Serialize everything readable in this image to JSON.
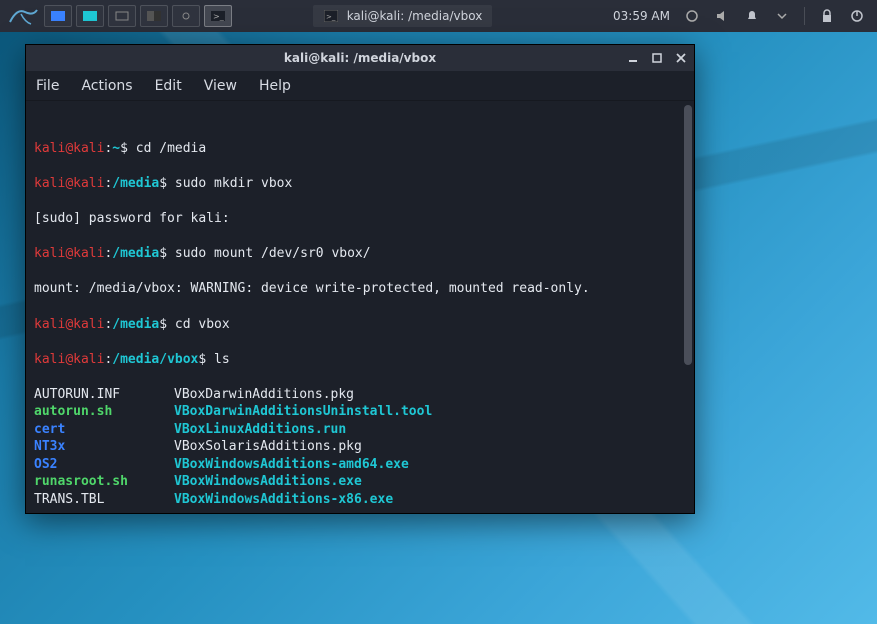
{
  "panel": {
    "window_title": "kali@kali: /media/vbox",
    "clock": "03:59 AM"
  },
  "terminal": {
    "titlebar": "kali@kali: /media/vbox",
    "menus": {
      "file": "File",
      "actions": "Actions",
      "edit": "Edit",
      "view": "View",
      "help": "Help"
    },
    "prompts": {
      "user": "kali",
      "at": "@",
      "host": "kali",
      "sep": ":",
      "tilde": "~",
      "dollar": "$",
      "path_media": "/media",
      "path_vbox": "/media/vbox"
    },
    "lines": {
      "cmd1": "cd /media",
      "cmd2": "sudo mkdir vbox",
      "sudo_pw": "[sudo] password for kali:",
      "cmd3": "sudo mount /dev/sr0 vbox/",
      "mount_warn": "mount: /media/vbox: WARNING: device write-protected, mounted read-only.",
      "cmd4": "cd vbox",
      "cmd5": "ls"
    },
    "ls": [
      {
        "l": "AUTORUN.INF",
        "lc": "c-white",
        "r": "VBoxDarwinAdditions.pkg",
        "rc": "c-white"
      },
      {
        "l": "autorun.sh",
        "lc": "c-green",
        "r": "VBoxDarwinAdditionsUninstall.tool",
        "rc": "c-teal"
      },
      {
        "l": "cert",
        "lc": "c-blue",
        "r": "VBoxLinuxAdditions.run",
        "rc": "c-teal"
      },
      {
        "l": "NT3x",
        "lc": "c-blue",
        "r": "VBoxSolarisAdditions.pkg",
        "rc": "c-white"
      },
      {
        "l": "OS2",
        "lc": "c-blue",
        "r": "VBoxWindowsAdditions-amd64.exe",
        "rc": "c-teal"
      },
      {
        "l": "runasroot.sh",
        "lc": "c-green",
        "r": "VBoxWindowsAdditions.exe",
        "rc": "c-teal"
      },
      {
        "l": "TRANS.TBL",
        "lc": "c-white",
        "r": "VBoxWindowsAdditions-x86.exe",
        "rc": "c-teal"
      }
    ]
  }
}
